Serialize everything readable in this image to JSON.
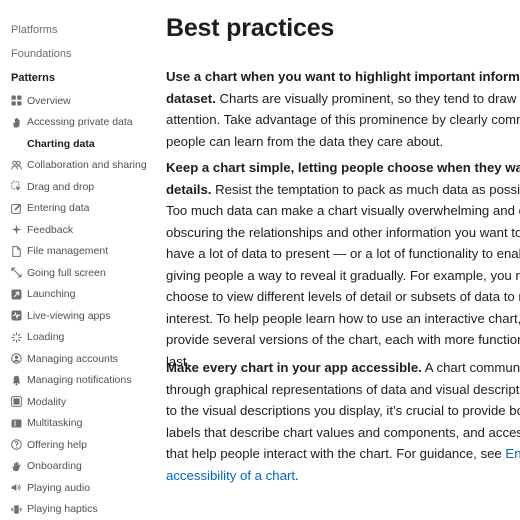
{
  "sidebar": {
    "platforms": "Platforms",
    "foundations": "Foundations",
    "patterns": "Patterns",
    "items": [
      {
        "label": "Overview",
        "icon": "grid-icon"
      },
      {
        "label": "Accessing private data",
        "icon": "hand-icon"
      },
      {
        "label": "Charting data",
        "icon": ""
      },
      {
        "label": "Collaboration and sharing",
        "icon": "collaboration-icon"
      },
      {
        "label": "Drag and drop",
        "icon": "drag-icon"
      },
      {
        "label": "Entering data",
        "icon": "pencil-icon"
      },
      {
        "label": "Feedback",
        "icon": "sparkle-icon"
      },
      {
        "label": "File management",
        "icon": "document-icon"
      },
      {
        "label": "Going full screen",
        "icon": "expand-arrows-icon"
      },
      {
        "label": "Launching",
        "icon": "launch-arrow-icon"
      },
      {
        "label": "Live-viewing apps",
        "icon": "waveform-icon"
      },
      {
        "label": "Loading",
        "icon": "spinner-icon"
      },
      {
        "label": "Managing accounts",
        "icon": "person-circle-icon"
      },
      {
        "label": "Managing notifications",
        "icon": "bell-icon"
      },
      {
        "label": "Modality",
        "icon": "square-icon"
      },
      {
        "label": "Multitasking",
        "icon": "split-view-icon"
      },
      {
        "label": "Offering help",
        "icon": "help-circle-icon"
      },
      {
        "label": "Onboarding",
        "icon": "wave-hand-icon"
      },
      {
        "label": "Playing audio",
        "icon": "speaker-icon"
      },
      {
        "label": "Playing haptics",
        "icon": "haptics-icon"
      }
    ]
  },
  "main": {
    "title": "Best practices",
    "p1": {
      "l1_bold": "Use a chart when you want to highlight important informa",
      "l2_bold": "dataset.",
      "l2_rest": " Charts are visually prominent, so they tend to draw p",
      "l3": "attention. Take advantage of this prominence by clearly commu",
      "l4": "people can learn from the data they care about."
    },
    "p2": {
      "l1_bold": "Keep a chart simple, letting people choose when they wa",
      "l2_bold": "details.",
      "l2_rest": " Resist the temptation to pack as much data as possibl",
      "l3": "Too much data can make a chart visually overwhelming and dif",
      "l4": "obscuring the relationships and other information you want to",
      "l5": "have a lot of data to present — or a lot of functionality to enab",
      "l6": "giving people a way to reveal it gradually. For example, you mig",
      "l7": "choose to view different levels of detail or subsets of data to m",
      "l8": "interest. To help people learn how to use an interactive chart, y",
      "l9": "provide several versions of the chart, each with more functiona",
      "l10": "last."
    },
    "p3": {
      "l1_bold": "Make every chart in your app accessible.",
      "l1_rest": " A chart communic",
      "l2": "through graphical representations of data and visual descriptio",
      "l3": "to the visual descriptions you display, it’s crucial to provide bot",
      "l4": "labels that describe chart values and components, and access",
      "l5_text": "that help people interact with the chart. For guidance, see ",
      "l5_link": "Enh",
      "l6_link": "accessibility of a chart",
      "l6_end": "."
    }
  },
  "colors": {
    "text": "#1d1d1f",
    "sidebar_text": "#515154",
    "link": "#0066cc"
  }
}
